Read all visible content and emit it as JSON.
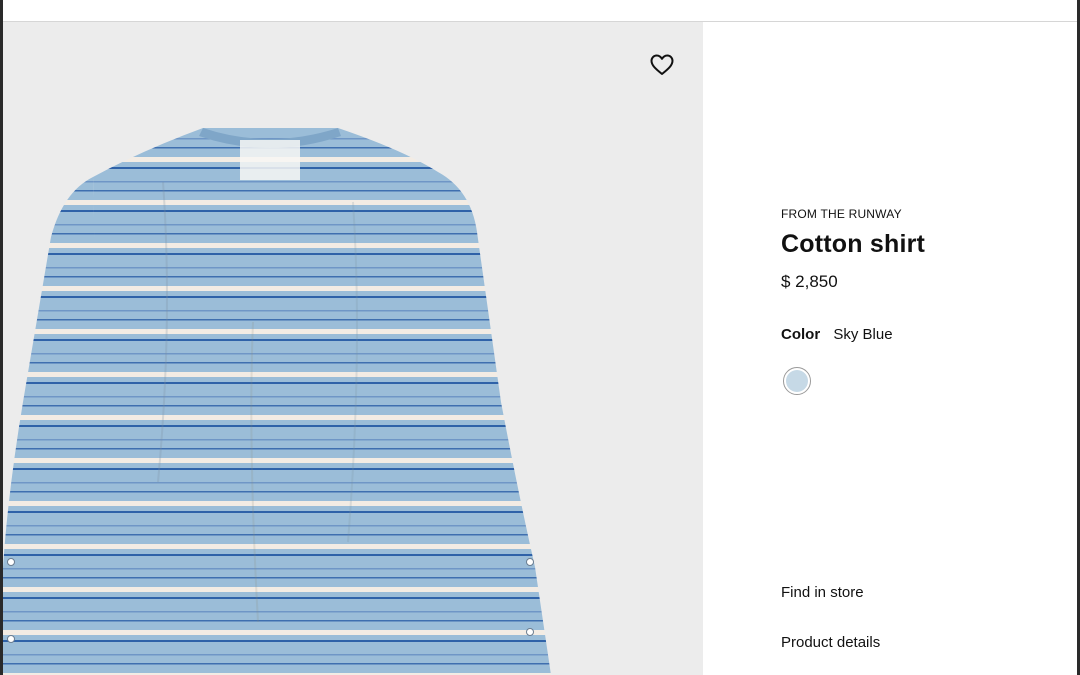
{
  "product": {
    "eyebrow": "FROM THE RUNWAY",
    "title": "Cotton shirt",
    "price": "$ 2,850",
    "color_label": "Color",
    "color_value": "Sky Blue",
    "swatch_color": "#c6d9e6"
  },
  "image": {
    "subject": "light blue striped long-sleeve shirt",
    "shirt_color": "#9bbdd8",
    "stripe_white": "#f3ece4",
    "stripe_navy": "#2f62a8"
  },
  "actions": {
    "wishlist_icon": "heart-icon",
    "find_in_store": "Find in store",
    "product_details": "Product details"
  }
}
